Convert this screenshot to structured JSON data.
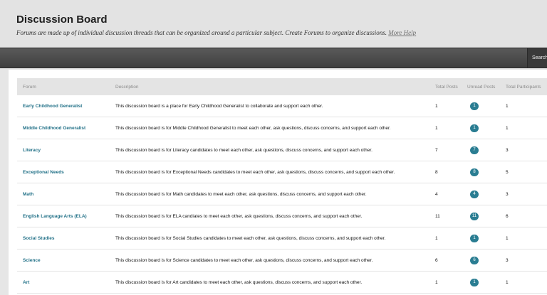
{
  "header": {
    "title": "Discussion Board",
    "description": "Forums are made up of individual discussion threads that can be organized around a particular subject. Create Forums to organize discussions.",
    "help_label": "More Help"
  },
  "toolbar": {
    "search_label": "Search"
  },
  "table": {
    "columns": [
      "Forum",
      "Description",
      "Total Posts",
      "Unread Posts",
      "Total Participants"
    ],
    "rows": [
      {
        "forum": "Early Childhood Generalist",
        "description": "This discussion board is a place for Early Childhood Generalist to collaborate and support each other.",
        "total": "1",
        "unread": "1",
        "participants": "1"
      },
      {
        "forum": "Middle Childhood Generalist",
        "description": "This discussion board is for Middle Childhood Generalist to meet each other, ask questions, discuss concerns, and support each other.",
        "total": "1",
        "unread": "1",
        "participants": "1"
      },
      {
        "forum": "Literacy",
        "description": "This discussion board is for Literacy candidates to meet each other, ask questions, discuss concerns, and support each other.",
        "total": "7",
        "unread": "7",
        "participants": "3"
      },
      {
        "forum": "Exceptional Needs",
        "description": "This discussion board is for Exceptional Needs candidates to meet each other, ask questions, discuss concerns, and support each other.",
        "total": "8",
        "unread": "8",
        "participants": "5"
      },
      {
        "forum": "Math",
        "description": "This discussion board is for Math candidates to meet each other, ask questions, discuss concerns, and support each other.",
        "total": "4",
        "unread": "4",
        "participants": "3"
      },
      {
        "forum": "English Language Arts (ELA)",
        "description": "This discussion board is for ELA candiates to meet each other, ask questions, discuss concerns, and support each other.",
        "total": "11",
        "unread": "11",
        "participants": "6"
      },
      {
        "forum": "Social Studies",
        "description": "This discussion board is for Social Studies candidates to meet each other, ask questions, discuss concerns, and support each other.",
        "total": "1",
        "unread": "1",
        "participants": "1"
      },
      {
        "forum": "Science",
        "description": "This discussion board is for Science candidates to meet each other, ask questions, discuss concerns, and support each other.",
        "total": "6",
        "unread": "6",
        "participants": "3"
      },
      {
        "forum": "Art",
        "description": "This discussion board is for Art candidates to meet each other, ask questions, discuss concerns, and support each other.",
        "total": "1",
        "unread": "1",
        "participants": "1"
      }
    ]
  },
  "colors": {
    "link": "#1f6f86",
    "badge": "#2a7d92",
    "toolbar": "#4a4a4a"
  }
}
